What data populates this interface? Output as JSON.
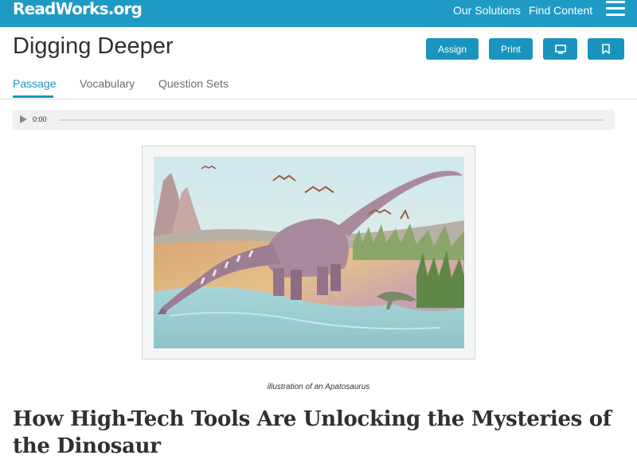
{
  "header": {
    "logo": "ReadWorks.org",
    "nav": [
      "Our Solutions",
      "Find Content"
    ],
    "menu_icon": "hamburger-menu-icon"
  },
  "page": {
    "title": "Digging Deeper",
    "buttons": {
      "assign": "Assign",
      "print": "Print",
      "present_icon": "monitor-icon",
      "bookmark_icon": "bookmark-icon"
    },
    "tabs": [
      "Passage",
      "Vocabulary",
      "Question Sets"
    ],
    "active_tab": "Passage"
  },
  "audio": {
    "time": "0:00",
    "play_icon": "play-icon"
  },
  "article": {
    "caption": "illustration of an Apatosaurus",
    "title": "How High-Tech Tools Are Unlocking the Mysteries of the Dinosaur"
  },
  "colors": {
    "brand": "#1e9bc4",
    "button": "#1b94bd",
    "title_text": "#303030"
  }
}
